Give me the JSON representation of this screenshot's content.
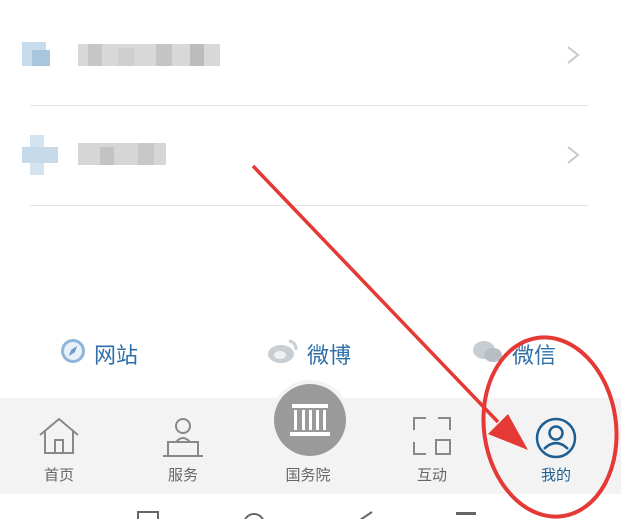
{
  "share": [
    {
      "label": "网站",
      "icon": "compass-icon"
    },
    {
      "label": "微博",
      "icon": "weibo-icon"
    },
    {
      "label": "微信",
      "icon": "wechat-icon"
    }
  ],
  "tabs": [
    {
      "label": "首页",
      "icon": "home-icon"
    },
    {
      "label": "服务",
      "icon": "service-icon"
    },
    {
      "label": "国务院",
      "icon": "state-council-icon"
    },
    {
      "label": "互动",
      "icon": "interaction-icon"
    },
    {
      "label": "我的",
      "icon": "user-icon",
      "active": true
    }
  ],
  "colors": {
    "accent": "#2f6fa6",
    "annotation": "#e53935",
    "tab_text": "#666666"
  }
}
